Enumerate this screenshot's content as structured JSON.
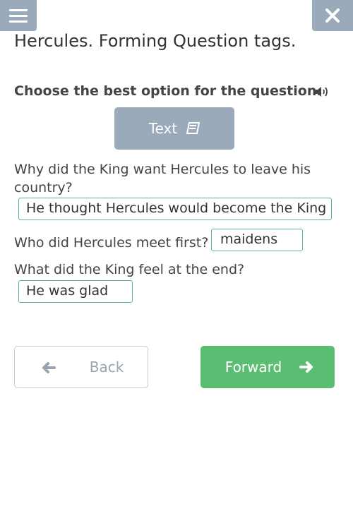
{
  "header": {
    "menu_icon": "hamburger-menu-icon",
    "close_icon": "close-icon",
    "title": "Hercules. Forming Question tags."
  },
  "task": {
    "instruction": "Choose the best option for the question.",
    "speaker_icon": "speaker-icon",
    "text_button_label": "Text",
    "text_button_icon": "book-icon"
  },
  "questions": [
    {
      "question": "Why did the King want Hercules to leave his country?",
      "answer": "He thought Hercules would become the King"
    },
    {
      "question": "Who did Hercules meet first?",
      "answer": "maidens"
    },
    {
      "question": "What did the King feel at the end?",
      "answer": "He was glad"
    }
  ],
  "navigation": {
    "back_label": "Back",
    "back_icon": "arrow-left-icon",
    "forward_label": "Forward",
    "forward_icon": "arrow-right-icon"
  },
  "colors": {
    "header_button": "#9aaabb",
    "answer_border": "#5bb58c",
    "forward_button": "#5bbd72"
  }
}
